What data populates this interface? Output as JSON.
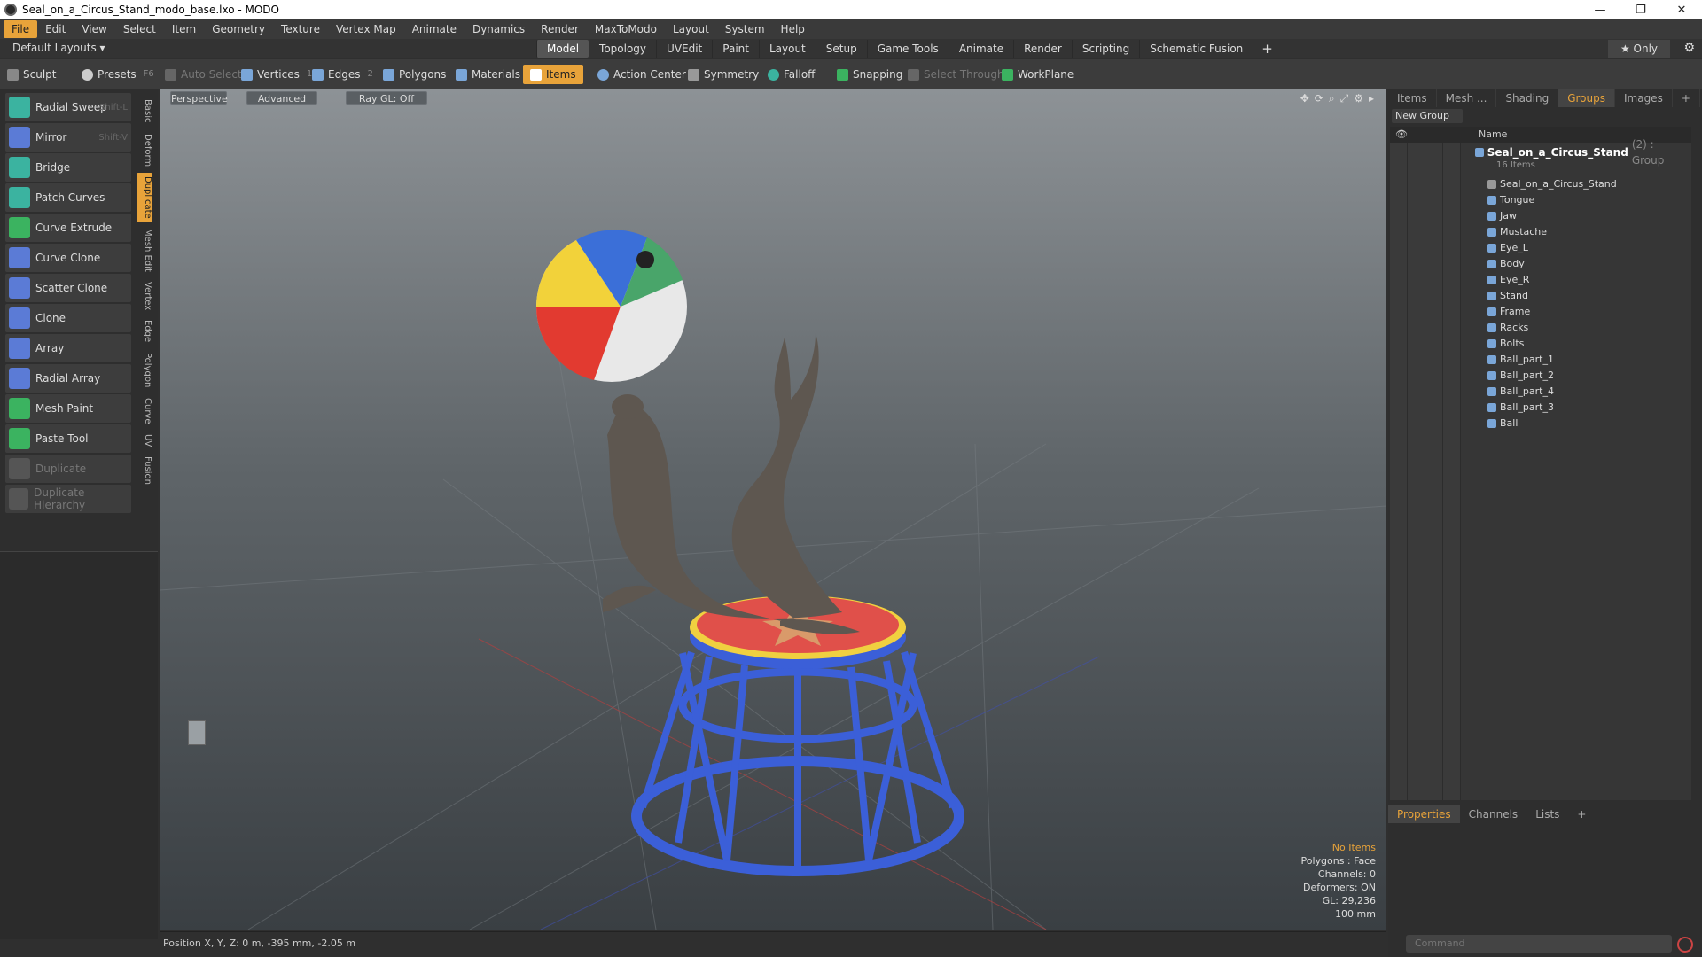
{
  "window": {
    "title": "Seal_on_a_Circus_Stand_modo_base.lxo - MODO",
    "minimize": "—",
    "restore": "❐",
    "close": "✕"
  },
  "menu": [
    "File",
    "Edit",
    "View",
    "Select",
    "Item",
    "Geometry",
    "Texture",
    "Vertex Map",
    "Animate",
    "Dynamics",
    "Render",
    "MaxToModo",
    "Layout",
    "System",
    "Help"
  ],
  "layoutbar": {
    "layouts": "Default Layouts ▾",
    "tabs": [
      "Model",
      "Topology",
      "UVEdit",
      "Paint",
      "Layout",
      "Setup",
      "Game Tools",
      "Animate",
      "Render",
      "Scripting",
      "Schematic Fusion"
    ],
    "selected_tab": "Model",
    "plus": "+",
    "only": "★  Only"
  },
  "toolbar": {
    "sculpt": "Sculpt",
    "presets": "Presets",
    "presets_key": "F6",
    "auto_select": "Auto Select",
    "vertices": "Vertices",
    "vertices_num": "1",
    "edges": "Edges",
    "edges_num": "2",
    "polygons": "Polygons",
    "materials": "Materials",
    "items": "Items",
    "action_center": "Action Center",
    "symmetry": "Symmetry",
    "falloff": "Falloff",
    "snapping": "Snapping",
    "select_through": "Select Through",
    "workplane": "WorkPlane"
  },
  "tools": [
    {
      "label": "Radial Sweep",
      "shortcut": "Shift-L",
      "color": "#3bb3a0"
    },
    {
      "label": "Mirror",
      "shortcut": "Shift-V",
      "color": "#5b7bd6"
    },
    {
      "label": "Bridge",
      "shortcut": "",
      "color": "#3bb3a0"
    },
    {
      "label": "Patch Curves",
      "shortcut": "",
      "color": "#3bb3a0"
    },
    {
      "label": "Curve Extrude",
      "shortcut": "",
      "color": "#3bb360"
    },
    {
      "label": "Curve Clone",
      "shortcut": "",
      "color": "#5b7bd6"
    },
    {
      "label": "Scatter Clone",
      "shortcut": "",
      "color": "#5b7bd6"
    },
    {
      "label": "Clone",
      "shortcut": "",
      "color": "#5b7bd6"
    },
    {
      "label": "Array",
      "shortcut": "",
      "color": "#5b7bd6"
    },
    {
      "label": "Radial Array",
      "shortcut": "",
      "color": "#5b7bd6"
    },
    {
      "label": "Mesh Paint",
      "shortcut": "",
      "color": "#3bb360"
    },
    {
      "label": "Paste Tool",
      "shortcut": "",
      "color": "#3bb360"
    },
    {
      "label": "Duplicate",
      "shortcut": "",
      "color": "#666"
    },
    {
      "label": "Duplicate Hierarchy",
      "shortcut": "",
      "color": "#666"
    }
  ],
  "vtabs": [
    "Basic",
    "Deform",
    "Duplicate",
    "Mesh Edit",
    "Vertex",
    "Edge",
    "Polygon",
    "Curve",
    "UV",
    "Fusion"
  ],
  "vtab_selected": "Duplicate",
  "viewport": {
    "perspective": "Perspective",
    "advanced": "Advanced",
    "raygl": "Ray GL: Off",
    "hud": {
      "no_items": "No Items",
      "polygons": "Polygons : Face",
      "channels": "Channels: 0",
      "deformers": "Deformers: ON",
      "gl": "GL: 29,236",
      "scale": "100 mm"
    }
  },
  "status": {
    "position": "Position X, Y, Z:  0 m, -395 mm, -2.05 m"
  },
  "rightpanel": {
    "tabs": [
      "Items",
      "Mesh ...",
      "Shading",
      "Groups",
      "Images",
      "+"
    ],
    "selected_tab": "Groups",
    "new_group": "New Group",
    "name_header": "Name",
    "group_name": "Seal_on_a_Circus_Stand",
    "group_suffix": "(2) : Group",
    "group_count": "16 Items",
    "children": [
      "Seal_on_a_Circus_Stand",
      "Tongue",
      "Jaw",
      "Mustache",
      "Eye_L",
      "Body",
      "Eye_R",
      "Stand",
      "Frame",
      "Racks",
      "Bolts",
      "Ball_part_1",
      "Ball_part_2",
      "Ball_part_4",
      "Ball_part_3",
      "Ball"
    ],
    "bottom_tabs": [
      "Properties",
      "Channels",
      "Lists",
      "+"
    ],
    "bottom_selected": "Properties",
    "command_placeholder": "Command"
  }
}
